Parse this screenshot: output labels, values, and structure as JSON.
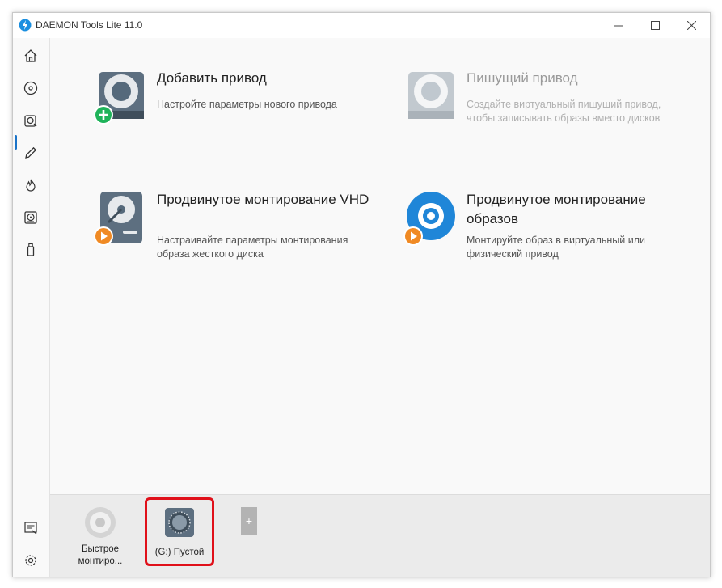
{
  "window": {
    "title": "DAEMON Tools Lite 11.0",
    "controls": {
      "minimize": "—",
      "maximize": "☐",
      "close": "✕"
    }
  },
  "sidebar": {
    "items": [
      {
        "icon": "home-icon"
      },
      {
        "icon": "disc-icon"
      },
      {
        "icon": "drive-disc-icon",
        "active": true
      },
      {
        "icon": "pencil-icon"
      },
      {
        "icon": "flame-icon"
      },
      {
        "icon": "disk-image-icon"
      },
      {
        "icon": "usb-drive-icon"
      }
    ],
    "bottom_items": [
      {
        "icon": "news-icon"
      },
      {
        "icon": "gear-icon"
      }
    ]
  },
  "tiles": [
    {
      "title": "Добавить привод",
      "desc": "Настройте параметры нового привода",
      "icon": "add-drive-icon",
      "enabled": true
    },
    {
      "title": "Пишущий привод",
      "desc": "Создайте виртуальный пишущий привод, чтобы записывать образы вместо дисков",
      "icon": "writer-drive-icon",
      "enabled": false
    },
    {
      "title": "Продвинутое монтирование VHD",
      "desc": "Настраивайте параметры монтирования образа жесткого диска",
      "icon": "vhd-mount-icon",
      "enabled": true
    },
    {
      "title": "Продвинутое монтирование образов",
      "desc": "Монтируйте образ в виртуальный или физический привод",
      "icon": "image-mount-icon",
      "enabled": true
    }
  ],
  "drives": [
    {
      "label": "Быстрое монтиро...",
      "icon": "quick-mount-icon"
    },
    {
      "label": "(G:) Пустой",
      "icon": "empty-drive-icon",
      "selected": true
    }
  ],
  "add_drive_label": "+",
  "colors": {
    "accent": "#1a73c8",
    "highlight": "#e0101a",
    "green": "#1fb35a",
    "orange": "#f08a24"
  }
}
